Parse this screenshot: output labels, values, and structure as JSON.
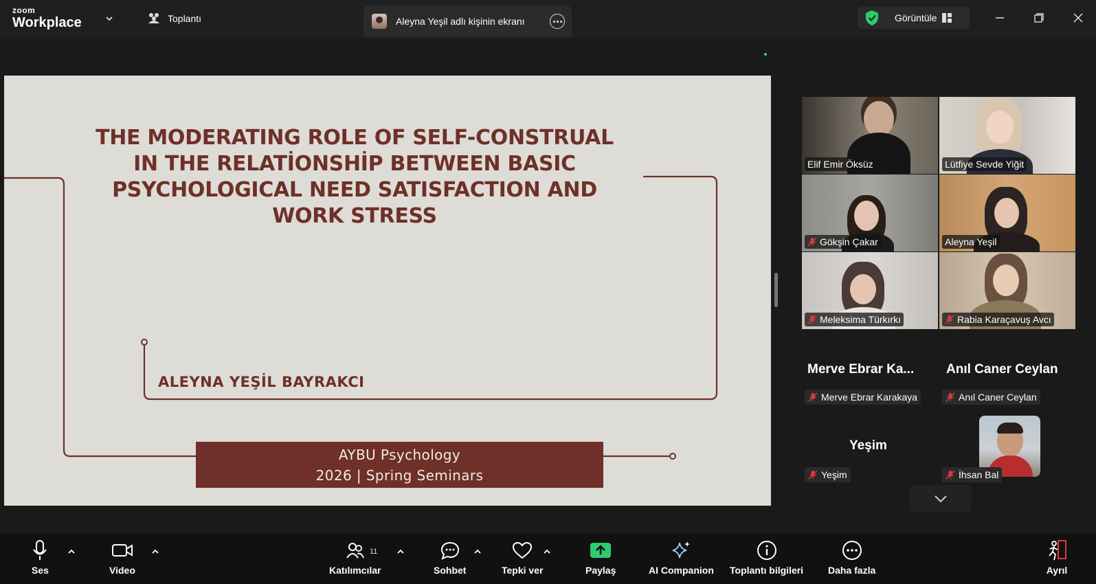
{
  "topbar": {
    "logo_top": "zoom",
    "logo_bottom": "Workplace",
    "meeting_label": "Toplantı",
    "share_tab_label": "Aleyna Yeşil adlı kişinin ekranı",
    "view_label": "Görüntüle"
  },
  "slide": {
    "title_lines": [
      "THE MODERATING ROLE OF SELF-CONSTRUAL",
      "IN THE RELATİONSHİP BETWEEN BASIC",
      "PSYCHOLOGICAL NEED SATISFACTION AND",
      "WORK STRESS"
    ],
    "author": "ALEYNA YEŞİL BAYRAKCI",
    "banner_line1": "AYBU Psychology",
    "banner_line2": "2026 | Spring Seminars",
    "colors": {
      "accent": "#6e3028",
      "background": "#dedcd7"
    }
  },
  "gallery": {
    "tiles": [
      {
        "name": "Elif Emir Öksüz",
        "muted": false,
        "active": false
      },
      {
        "name": "Lütfiye Sevde Yiğit",
        "muted": false,
        "active": true
      },
      {
        "name": "Gökşin Çakar",
        "muted": true,
        "active": false
      },
      {
        "name": "Aleyna Yeşil",
        "muted": false,
        "active": false
      },
      {
        "name": "Meleksima Türkırkı",
        "muted": true,
        "active": false
      },
      {
        "name": "Rabia Karaçavuş Avcı",
        "muted": true,
        "active": false
      }
    ],
    "no_video": [
      {
        "display": "Merve  Ebrar  Ka...",
        "label": "Merve Ebrar Karakaya"
      },
      {
        "display": "Anıl Caner Ceylan",
        "label": "Anıl Caner Ceylan"
      },
      {
        "display": "Yeşim",
        "label": "Yeşim"
      }
    ],
    "ihsan_label": "İhsan Bal"
  },
  "toolbar": {
    "audio": "Ses",
    "video": "Video",
    "participants": "Katılımcılar",
    "participants_count": "11",
    "chat": "Sohbet",
    "react": "Tepki ver",
    "share": "Paylaş",
    "ai": "AI Companion",
    "info": "Toplantı bilgileri",
    "more": "Daha fazla",
    "leave": "Ayrıl",
    "colors": {
      "share_green": "#2dcc70",
      "leave_red": "#e0383e"
    }
  }
}
